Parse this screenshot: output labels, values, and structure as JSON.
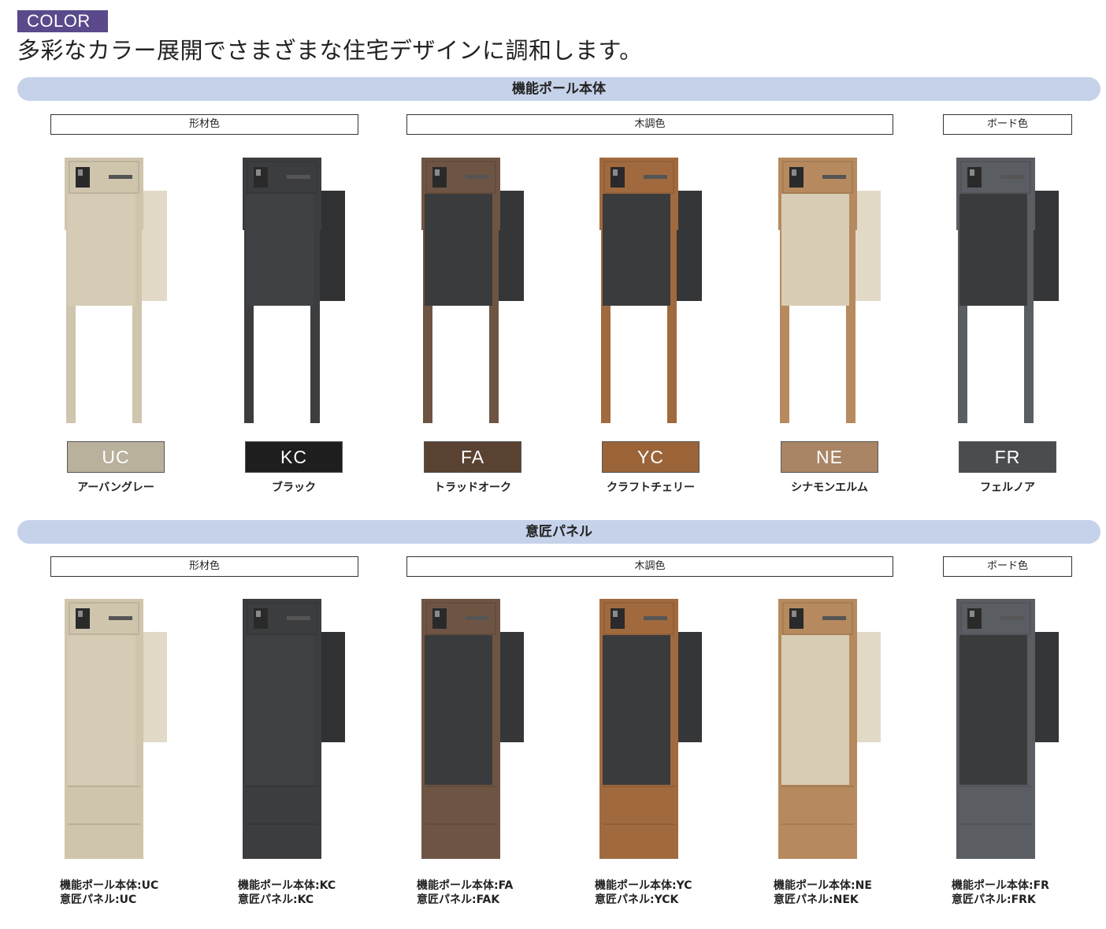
{
  "tag": "COLOR",
  "headline": "多彩なカラー展開でさまざまな住宅デザインに調和します。",
  "sections": {
    "pole": {
      "title": "機能ポール本体",
      "groups": [
        "形材色",
        "木調色",
        "ボード色"
      ],
      "variants": [
        {
          "code": "UC",
          "name": "アーバングレー"
        },
        {
          "code": "KC",
          "name": "ブラック"
        },
        {
          "code": "FA",
          "name": "トラッドオーク"
        },
        {
          "code": "YC",
          "name": "クラフトチェリー"
        },
        {
          "code": "NE",
          "name": "シナモンエルム"
        },
        {
          "code": "FR",
          "name": "フェルノア"
        }
      ]
    },
    "panel": {
      "title": "意匠パネル",
      "groups": [
        "形材色",
        "木調色",
        "ボード色"
      ],
      "variants": [
        {
          "line1": "機能ポール本体:UC",
          "line2": "意匠パネル:UC"
        },
        {
          "line1": "機能ポール本体:KC",
          "line2": "意匠パネル:KC"
        },
        {
          "line1": "機能ポール本体:FA",
          "line2": "意匠パネル:FAK"
        },
        {
          "line1": "機能ポール本体:YC",
          "line2": "意匠パネル:YCK"
        },
        {
          "line1": "機能ポール本体:NE",
          "line2": "意匠パネル:NEK"
        },
        {
          "line1": "機能ポール本体:FR",
          "line2": "意匠パネル:FRK"
        }
      ]
    }
  },
  "colors": {
    "UC": {
      "frame": "#cfc5ad",
      "side": "#e2dac7",
      "door": "#d6ccb5",
      "swatch": "#b9b19c"
    },
    "KC": {
      "frame": "#3b3d3f",
      "side": "#2f3133",
      "door": "#3f4144",
      "swatch": "#1e1e1e"
    },
    "FA": {
      "frame": "#6e5543",
      "side": "#353638",
      "door": "#3a3b3d",
      "swatch": "#5a4232"
    },
    "YC": {
      "frame": "#a16a3e",
      "side": "#353638",
      "door": "#3a3b3d",
      "swatch": "#9a6438"
    },
    "NE": {
      "frame": "#b68a5e",
      "side": "#e2dac7",
      "door": "#d8cdb4",
      "swatch": "#a98566"
    },
    "FR": {
      "frame": "#5a5d62",
      "side": "#353638",
      "door": "#3a3b3d",
      "swatch": "#4a4c4f"
    }
  }
}
